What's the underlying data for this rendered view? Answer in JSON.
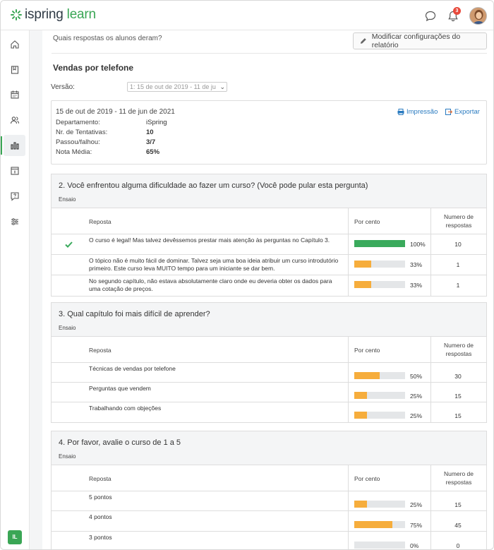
{
  "header": {
    "logo_prefix": "ispring",
    "logo_suffix": "learn",
    "notification_count": "3",
    "user_initials": "IL"
  },
  "report": {
    "question": "Quais respostas os alunos deram?",
    "modify_button": "Modificar configurações do relatório",
    "title": "Vendas por telefone",
    "version_label": "Versão:",
    "version_value": "1: 15 de out de 2019 - 11 de ju"
  },
  "summary": {
    "date_range": "15 de out de 2019 - 11 de jun de 2021",
    "print_label": "Impressão",
    "export_label": "Exportar",
    "rows": [
      {
        "label": "Departamento:",
        "value": "iSpring"
      },
      {
        "label": "Nr. de Tentativas:",
        "value": "10"
      },
      {
        "label": "Passou/falhou:",
        "value": "3/7"
      },
      {
        "label": "Nota Média:",
        "value": "65%"
      }
    ]
  },
  "table_headers": {
    "answer": "Reposta",
    "percent": "Por cento",
    "count_line1": "Numero de",
    "count_line2": "respostas"
  },
  "questions": [
    {
      "title": "2. Você enfrentou alguma dificuldade ao fazer um curso? (Você pode pular esta pergunta)",
      "type": "Ensaio",
      "answers": [
        {
          "text": "O curso é legal! Mas talvez devêssemos prestar mais atenção às perguntas no Capítulo 3.",
          "percent": 100,
          "percent_label": "100%",
          "count": "10",
          "correct": true
        },
        {
          "text": "O tópico não é muito fácil de dominar. Talvez seja uma boa ideia atribuir um curso introdutório primeiro. Este curso leva MUITO tempo para um iniciante se dar bem.",
          "percent": 33,
          "percent_label": "33%",
          "count": "1",
          "correct": false
        },
        {
          "text": "No segundo capítulo, não estava absolutamente claro onde eu deveria obter os dados para uma cotação de preços.",
          "percent": 33,
          "percent_label": "33%",
          "count": "1",
          "correct": false
        }
      ]
    },
    {
      "title": "3. Qual capítulo foi mais difícil de aprender?",
      "type": "Ensaio",
      "answers": [
        {
          "text": "Técnicas de vendas por telefone",
          "percent": 50,
          "percent_label": "50%",
          "count": "30",
          "correct": false
        },
        {
          "text": "Perguntas que vendem",
          "percent": 25,
          "percent_label": "25%",
          "count": "15",
          "correct": false
        },
        {
          "text": "Trabalhando com objeções",
          "percent": 25,
          "percent_label": "25%",
          "count": "15",
          "correct": false
        }
      ]
    },
    {
      "title": "4. Por favor, avalie o curso de 1 a 5",
      "type": "Ensaio",
      "answers": [
        {
          "text": "5 pontos",
          "percent": 25,
          "percent_label": "25%",
          "count": "15",
          "correct": false
        },
        {
          "text": "4 pontos",
          "percent": 75,
          "percent_label": "75%",
          "count": "45",
          "correct": false
        },
        {
          "text": "3 pontos",
          "percent": 0,
          "percent_label": "0%",
          "count": "0",
          "correct": false
        }
      ]
    }
  ],
  "colors": {
    "brand_green": "#3aa655",
    "bar_orange": "#f6ad3c",
    "bar_green": "#3aaa5c",
    "link_blue": "#2a7bc0"
  }
}
